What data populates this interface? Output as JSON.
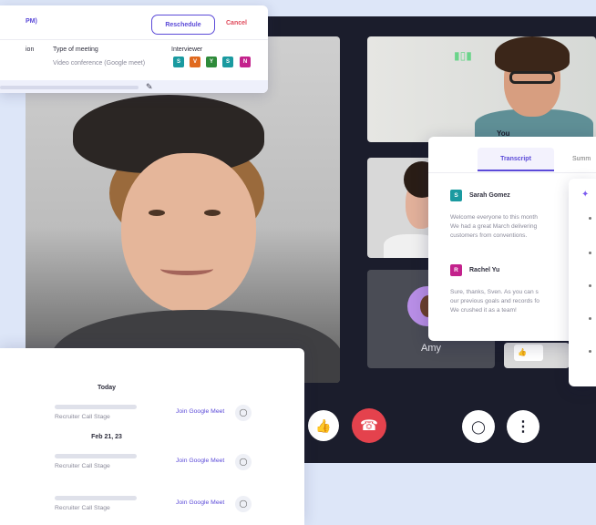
{
  "meeting_card": {
    "time_fragment": "PM)",
    "reschedule_label": "Reschedule",
    "cancel_label": "Cancel",
    "col1_header": "ion",
    "col2_header": "Type of meeting",
    "col2_value": "Video conference (Google meet)",
    "col3_header": "Interviewer",
    "interviewers": [
      {
        "initial": "S",
        "color": "#1a9aa0"
      },
      {
        "initial": "V",
        "color": "#e06a1f"
      },
      {
        "initial": "Y",
        "color": "#2e8b3a"
      },
      {
        "initial": "S",
        "color": "#1a9aa0"
      },
      {
        "initial": "N",
        "color": "#c3228c"
      }
    ]
  },
  "call": {
    "amy_name": "Amy",
    "you_label": "You"
  },
  "transcript": {
    "tab_transcript": "Transcript",
    "tab_summary": "Summ",
    "entries": [
      {
        "initial": "S",
        "color": "#1a9aa0",
        "name": "Sarah Gomez",
        "text": "Welcome everyone to this month\nWe had a great March delivering\ncustomers from conventions."
      },
      {
        "initial": "R",
        "color": "#c3228c",
        "name": "Rachel Yu",
        "text": "Sure, thanks, Sven. As you can s\nour previous goals and records fo\nWe crushed it as a team!"
      }
    ]
  },
  "schedule": {
    "groups": [
      {
        "date": "Today",
        "stage": "Recruiter Call Stage",
        "join": "Join Google Meet"
      },
      {
        "date": "Feb 21, 23",
        "stage": "Recruiter Call Stage",
        "join": "Join Google Meet"
      },
      {
        "date": "",
        "stage": "Recruiter Call Stage",
        "join": "Join Google Meet"
      }
    ]
  }
}
